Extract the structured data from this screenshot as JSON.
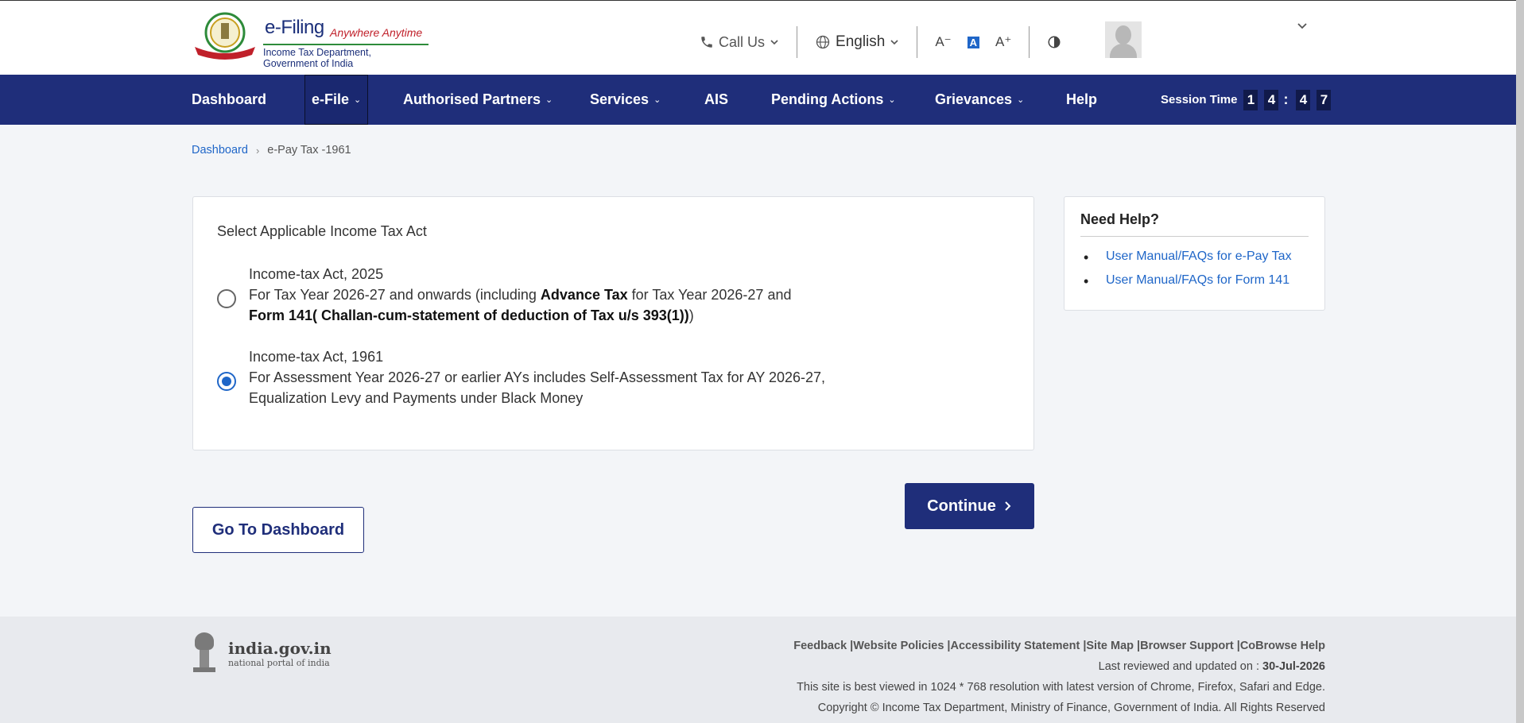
{
  "header": {
    "brand": "e-Filing",
    "tagline": "Anywhere Anytime",
    "department": "Income Tax Department, Government of India",
    "call_us": "Call Us",
    "language": "English",
    "font_decrease": "A⁻",
    "font_normal": "A",
    "font_increase": "A⁺",
    "contrast_icon": "contrast-icon"
  },
  "nav": {
    "items": [
      {
        "label": "Dashboard"
      },
      {
        "label": "e-File"
      },
      {
        "label": "Authorised Partners"
      },
      {
        "label": "Services"
      },
      {
        "label": "AIS"
      },
      {
        "label": "Pending Actions"
      },
      {
        "label": "Grievances"
      },
      {
        "label": "Help"
      }
    ],
    "session_label": "Session Time",
    "session_digits": [
      "1",
      "4",
      "4",
      "7"
    ]
  },
  "breadcrumb": {
    "home": "Dashboard",
    "current": "e-Pay Tax -1961"
  },
  "card": {
    "title": "Select Applicable Income Tax Act",
    "options": [
      {
        "heading": "Income-tax Act, 2025",
        "line1_pre": "For Tax Year 2026-27 and onwards (including ",
        "line1_bold": "Advance Tax",
        "line1_post": " for Tax Year 2026-27 and",
        "line2_bold": "Form 141( Challan-cum-statement of deduction of Tax u/s 393(1))",
        "line2_post": ")",
        "selected": false
      },
      {
        "heading": "Income-tax Act, 1961",
        "line1": "For Assessment Year 2026-27 or earlier AYs includes Self-Assessment Tax for AY 2026-27,",
        "line2": "Equalization Levy and Payments under Black Money",
        "selected": true
      }
    ]
  },
  "help": {
    "title": "Need Help?",
    "links": [
      "User Manual/FAQs for e-Pay Tax",
      "User Manual/FAQs for Form 141"
    ]
  },
  "buttons": {
    "continue": "Continue",
    "go_dashboard": "Go To Dashboard"
  },
  "footer": {
    "portal_name": "india.gov.in",
    "portal_sub": "national portal of india",
    "links": [
      "Feedback",
      "Website Policies",
      "Accessibility Statement",
      "Site Map",
      "Browser Support",
      "CoBrowse Help"
    ],
    "last_reviewed_label": "Last reviewed and updated on : ",
    "last_reviewed_date": "30-Jul-2026",
    "best_viewed": "This site is best viewed in 1024 * 768 resolution with latest version of Chrome, Firefox, Safari and Edge.",
    "copyright": "Copyright © Income Tax Department, Ministry of Finance, Government of India. All Rights Reserved"
  },
  "colors": {
    "nav_bg": "#1f2e7a",
    "link": "#1f66c8",
    "page_bg": "#f3f5f8"
  }
}
